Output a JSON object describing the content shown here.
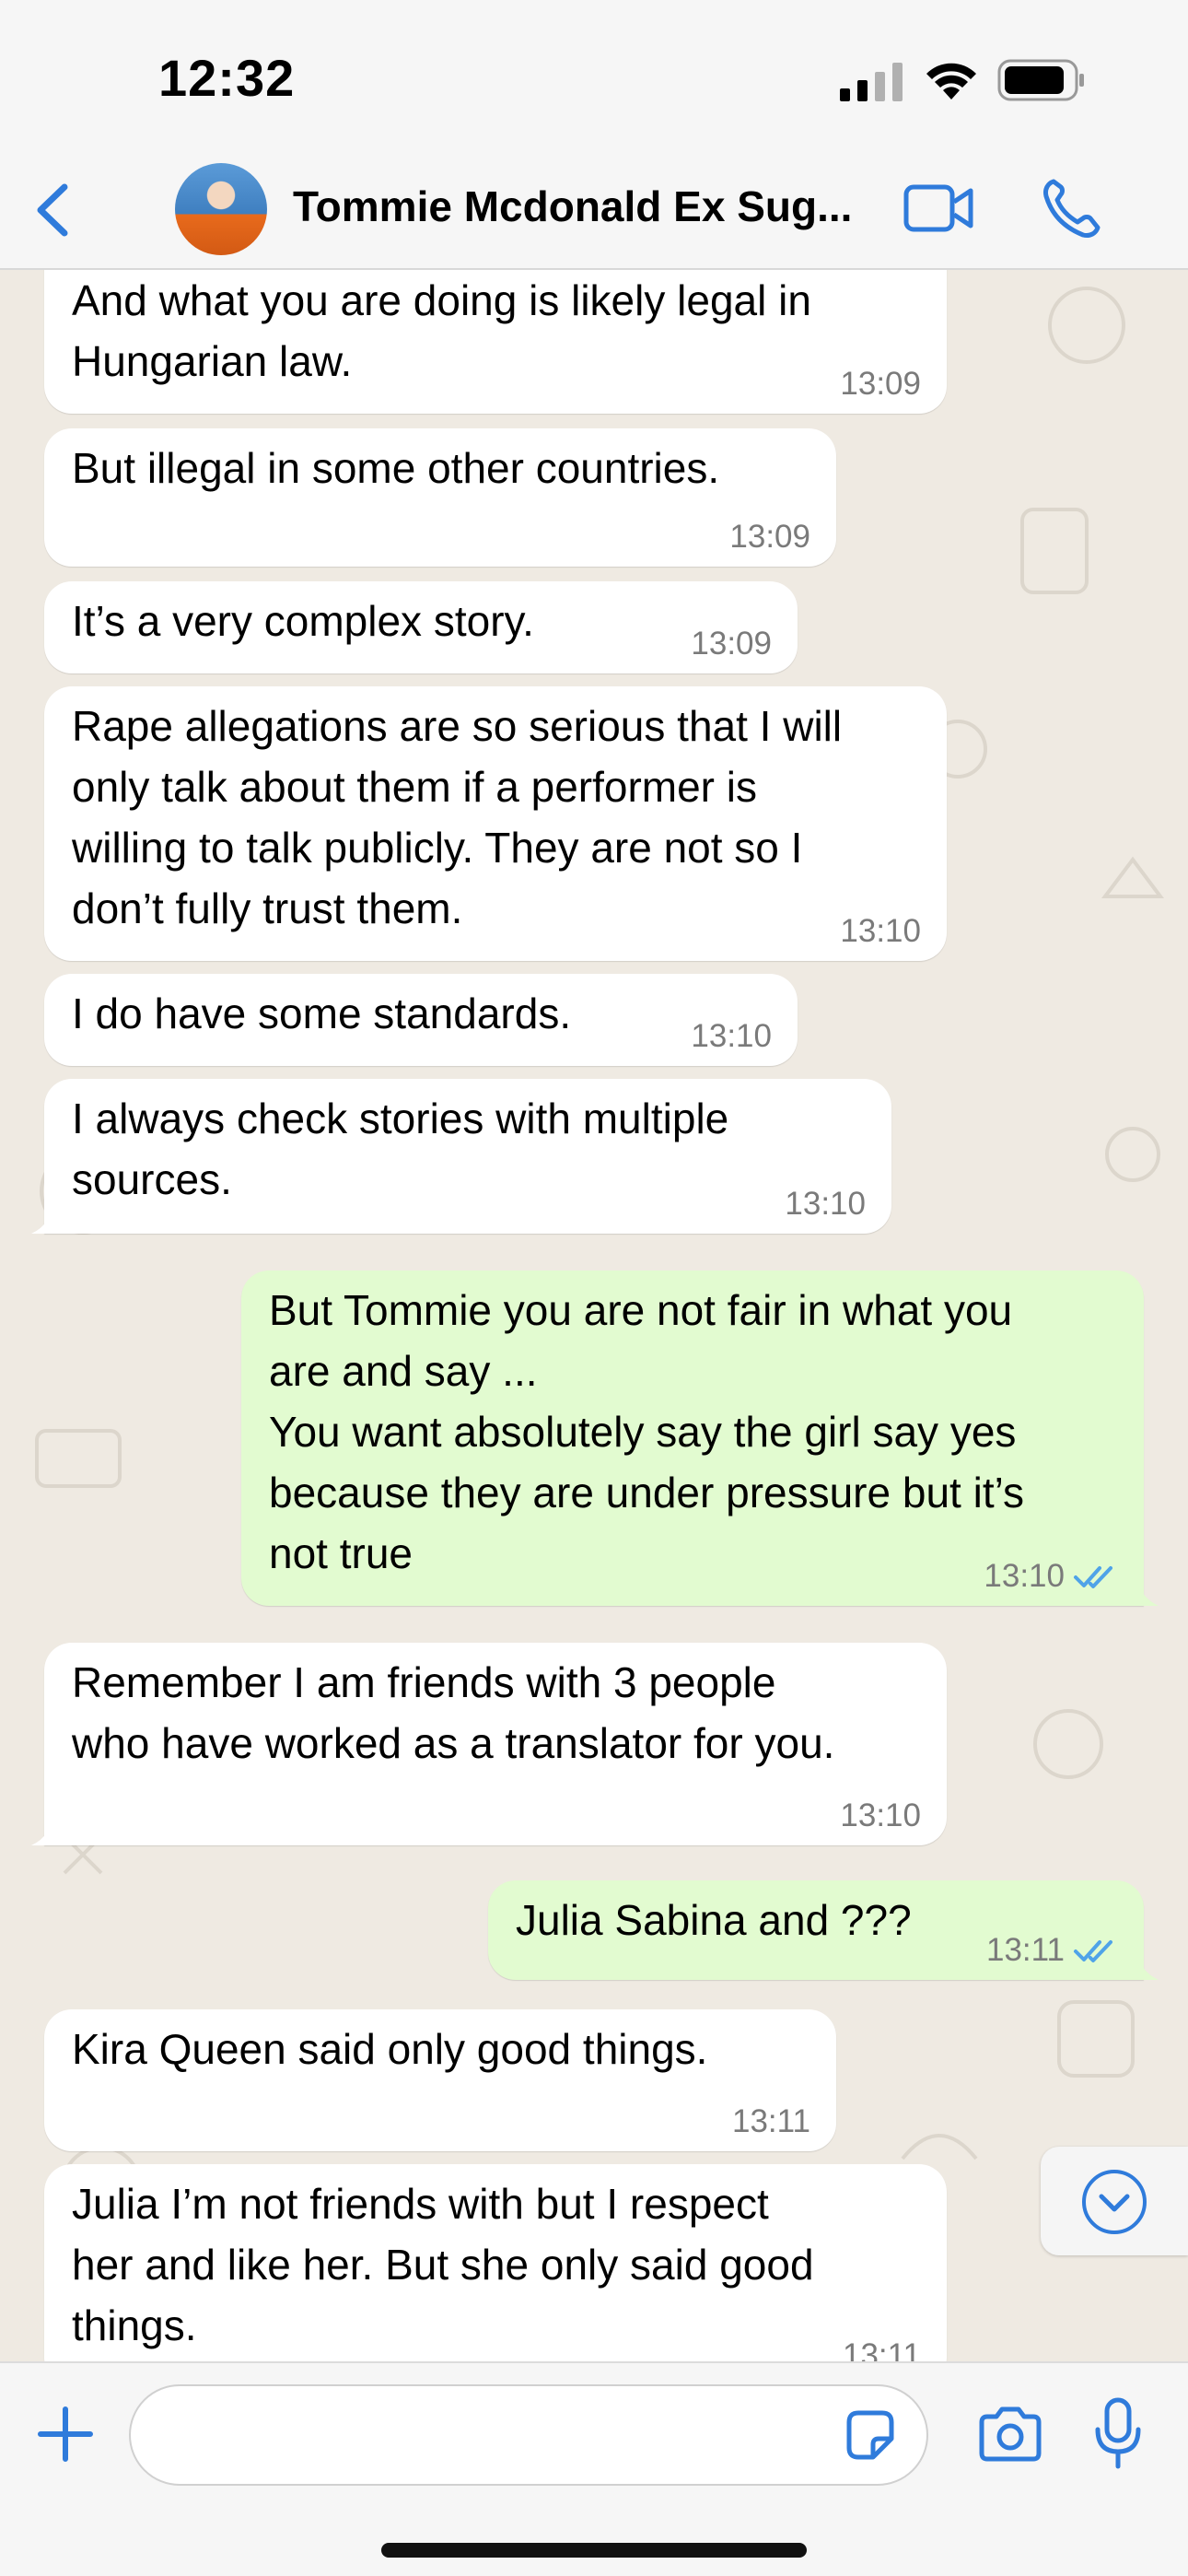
{
  "status_bar": {
    "time": "12:32"
  },
  "header": {
    "contact_name": "Tommie  Mcdonald Ex Sug..."
  },
  "messages": [
    {
      "direction": "incoming",
      "text": "And what you are doing is likely legal in\nHungarian law.",
      "time": "13:09"
    },
    {
      "direction": "incoming",
      "text": "But illegal in some other countries.",
      "time": "13:09"
    },
    {
      "direction": "incoming",
      "text": "It’s a very complex story.",
      "time": "13:09"
    },
    {
      "direction": "incoming",
      "text": "Rape allegations are so serious that I will\nonly talk about them if a performer is\nwilling to talk publicly. They are not so I\ndon’t fully trust them.",
      "time": "13:10"
    },
    {
      "direction": "incoming",
      "text": "I do have some standards.",
      "time": "13:10"
    },
    {
      "direction": "incoming",
      "text": "I always check stories with multiple\nsources.",
      "time": "13:10"
    },
    {
      "direction": "outgoing",
      "text": "But Tommie you are not fair in what you\nare and say ...\nYou want absolutely say the girl say yes\nbecause they are under pressure but it’s\nnot true",
      "time": "13:10",
      "status": "read"
    },
    {
      "direction": "incoming",
      "text": "Remember I am friends with 3 people\nwho have worked as a translator for you.",
      "time": "13:10"
    },
    {
      "direction": "outgoing",
      "text": "Julia Sabina and ???",
      "time": "13:11",
      "status": "read"
    },
    {
      "direction": "incoming",
      "text": "Kira Queen said only good things.",
      "time": "13:11"
    },
    {
      "direction": "incoming",
      "text": "Julia I’m not friends with but I respect\nher and like her. But she only said good\nthings.",
      "time": "13:11"
    }
  ],
  "composer": {
    "placeholder": ""
  },
  "icons": {
    "back": "chevron-left-icon",
    "video": "video-camera-icon",
    "call": "phone-icon",
    "add": "plus-icon",
    "sticker": "sticker-icon",
    "camera": "camera-icon",
    "mic": "microphone-icon",
    "scroll": "chevron-down-circle-icon"
  },
  "colors": {
    "accent": "#2f7bdb",
    "chat_background": "#efeae2",
    "incoming_bubble": "#ffffff",
    "outgoing_bubble": "#e2fbd0",
    "read_ticks": "#4fa3e8",
    "timestamp": "#7a7a7a"
  }
}
